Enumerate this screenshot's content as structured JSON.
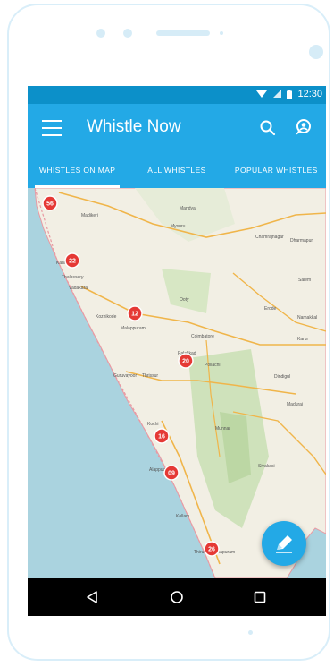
{
  "status_bar": {
    "time": "12:30",
    "icons": [
      "wifi-icon",
      "signal-icon",
      "battery-icon"
    ]
  },
  "app_bar": {
    "title": "Whistle Now",
    "icons": [
      "menu-icon",
      "search-icon",
      "profile-icon"
    ]
  },
  "tabs": [
    {
      "label": "WHISTLES ON MAP",
      "active": true
    },
    {
      "label": "ALL WHISTLES",
      "active": false
    },
    {
      "label": "POPULAR WHISTLES",
      "active": false
    }
  ],
  "map": {
    "place_labels": [
      "Madikeri",
      "Mandya",
      "Mysuru",
      "Kannur",
      "Thalassery",
      "Vadakara",
      "Kozhikode",
      "Malappuram",
      "Coimbatore",
      "Palakkad",
      "Pollachi",
      "Guruvayoor",
      "Thrissur",
      "Kochi",
      "Munnar",
      "Alappuzha",
      "Kollam",
      "Thiruvananthapuram",
      "Madurai",
      "Dindigul",
      "Erode",
      "Salem",
      "Namakkal",
      "Dharmapuri",
      "Karur",
      "Ooty",
      "Chamrajnagar",
      "Sivakasi"
    ],
    "markers": [
      {
        "count": "56",
        "place": "Kasaragod"
      },
      {
        "count": "22",
        "place": "Kannur"
      },
      {
        "count": "12",
        "place": "Kozhikode"
      },
      {
        "count": "20",
        "place": "Palakkad"
      },
      {
        "count": "16",
        "place": "Kochi"
      },
      {
        "count": "09",
        "place": "Alappuzha"
      },
      {
        "count": "26",
        "place": "Thiruvananthapuram"
      }
    ]
  },
  "fab": {
    "icon": "pencil-icon"
  },
  "nav_bar": {
    "icons": [
      "back-icon",
      "home-icon",
      "recents-icon"
    ]
  },
  "colors": {
    "primary": "#23a9e6",
    "primary_dark": "#0c90c9",
    "marker": "#e53935",
    "sea": "#aad3df",
    "land": "#f2efe4"
  }
}
